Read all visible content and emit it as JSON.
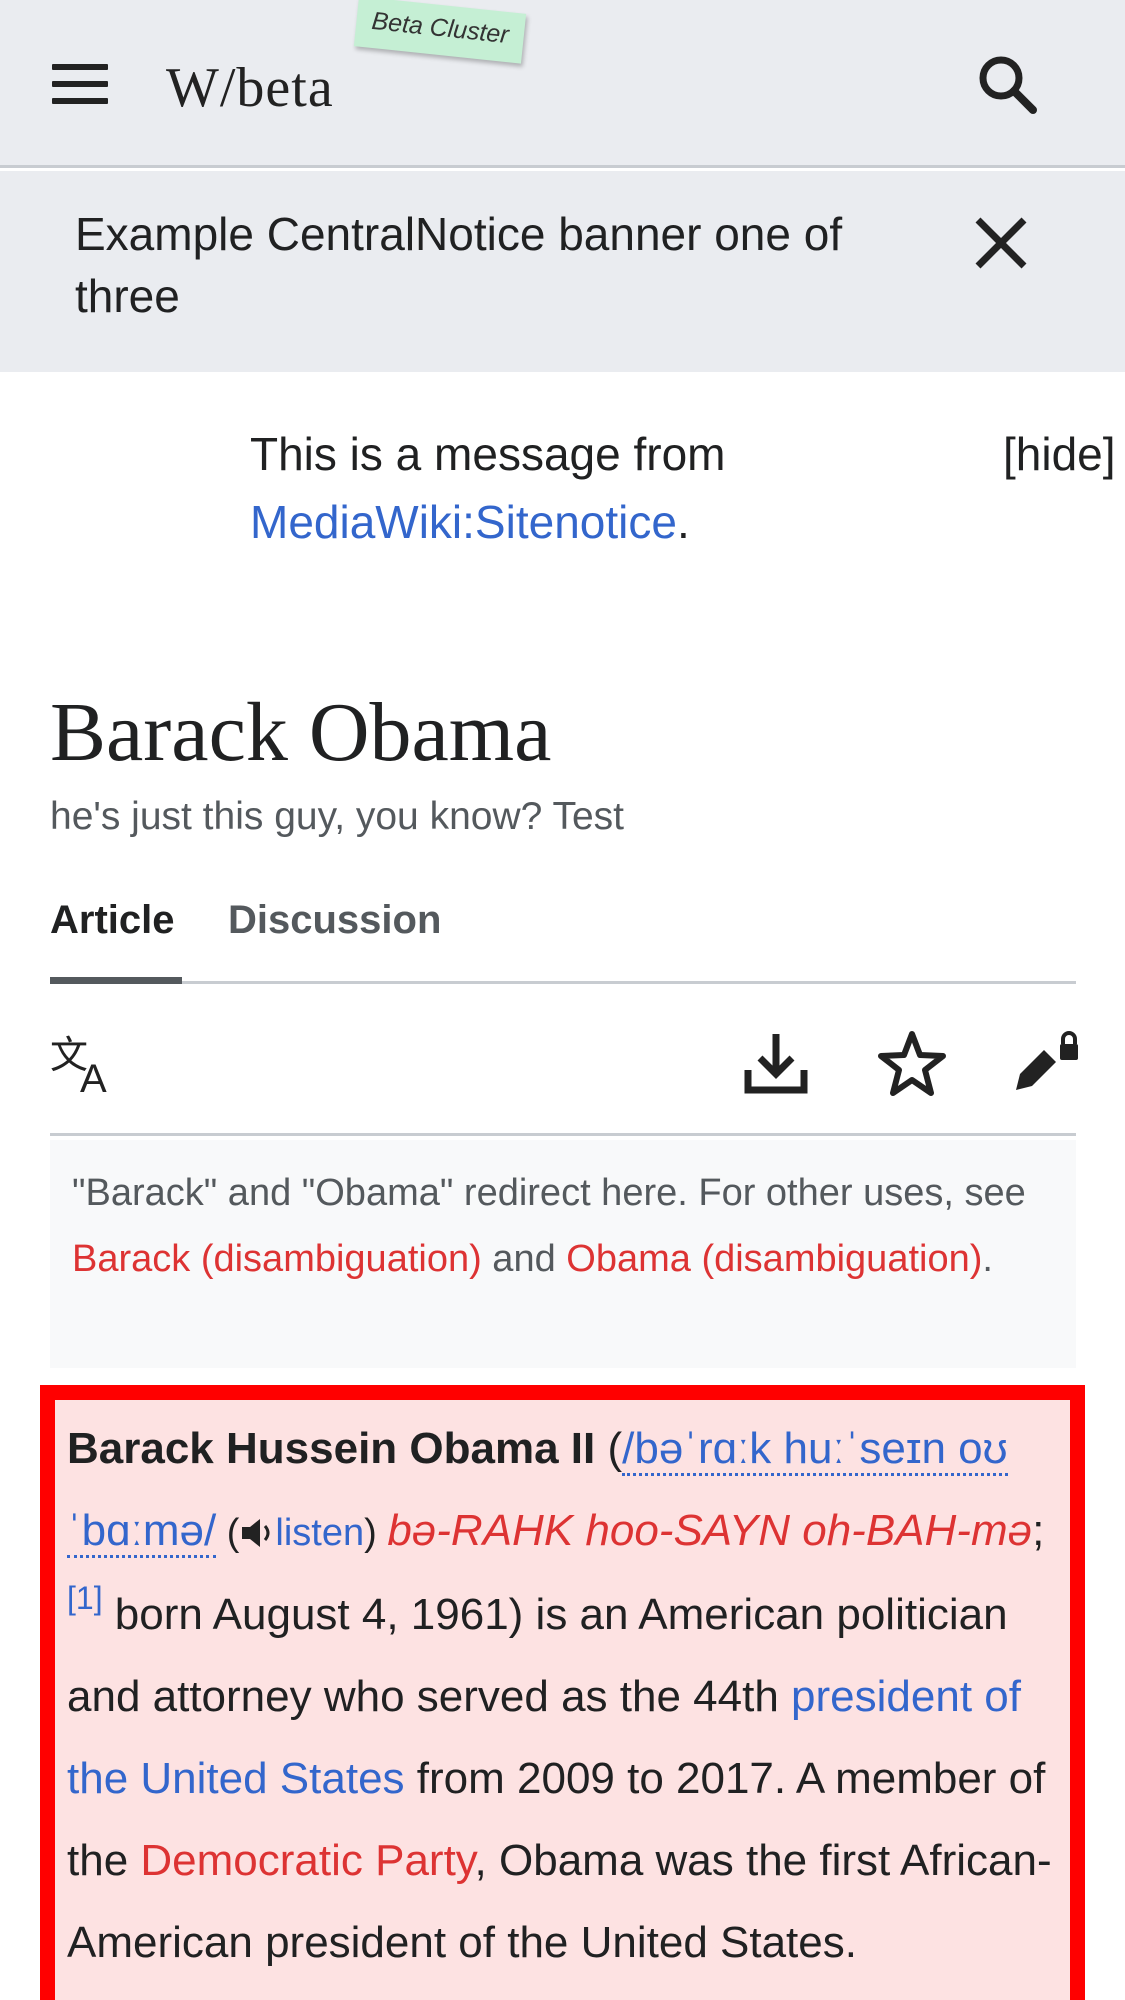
{
  "header": {
    "logo_text": "W/beta",
    "beta_tag": "Beta Cluster",
    "icons": [
      "menu-icon",
      "search-icon"
    ]
  },
  "banner": {
    "text": "Example CentralNotice banner one of three",
    "close_icon": "close-icon"
  },
  "sitenotice": {
    "prefix": "This is a message from ",
    "link": "MediaWiki:Sitenotice",
    "suffix": ".",
    "hide_label": "[hide]"
  },
  "page": {
    "title": "Barack Obama",
    "tagline": "he's just this guy, you know? Test"
  },
  "tabs": [
    {
      "label": "Article",
      "active": true
    },
    {
      "label": "Discussion",
      "active": false
    }
  ],
  "actions": {
    "icons": [
      "language-icon",
      "download-icon",
      "watch-star-icon",
      "edit-locked-icon"
    ]
  },
  "hatnote": {
    "text1": "\"Barack\" and \"Obama\" redirect here. For other uses, see ",
    "link1": "Barack (disambiguation)",
    "text2": " and ",
    "link2": "Obama (disambiguation)",
    "text3": "."
  },
  "lead": {
    "bold_name": "Barack Hussein Obama II",
    "open_paren": " (",
    "ipa": "/bəˈrɑːk huːˈseɪn oʊˈbɑːmə/",
    "listen_open": " (",
    "listen_icon": "speaker-icon",
    "listen_label": "listen",
    "listen_close": ") ",
    "respelling": "bə-RAHK hoo-SAYN oh-BAH-mə",
    "semicolon": ";",
    "ref": "[1]",
    "text1": " born August 4, 1961) is an American politician and attorney who served as the 44th ",
    "link_president": "president of the United States",
    "text2": " from 2009 to 2017. A member of the ",
    "link_party": "Democratic Party",
    "text3": ", Obama was the first African-American president of the United States."
  },
  "colors": {
    "link_blue": "#3366cc",
    "link_red": "#d33",
    "highlight_border": "#ff0000",
    "highlight_fill": "#fde2e2"
  }
}
